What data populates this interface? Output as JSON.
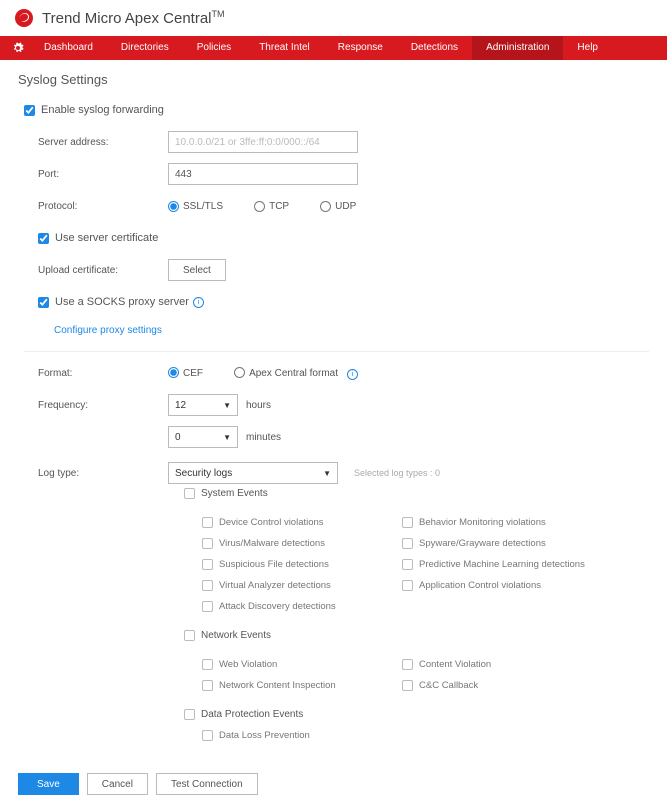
{
  "header": {
    "product": "Trend Micro Apex Central",
    "tm": "TM"
  },
  "nav": {
    "items": [
      "Dashboard",
      "Directories",
      "Policies",
      "Threat Intel",
      "Response",
      "Detections",
      "Administration",
      "Help"
    ],
    "activeIndex": 6
  },
  "page": {
    "title": "Syslog Settings"
  },
  "form": {
    "enable": {
      "label": "Enable syslog forwarding"
    },
    "server": {
      "label": "Server address:",
      "placeholder": "10.0.0.0/21 or 3ffe:ff:0:0/000::/64"
    },
    "port": {
      "label": "Port:",
      "value": "443"
    },
    "protocol": {
      "label": "Protocol:",
      "ssl": "SSL/TLS",
      "tcp": "TCP",
      "udp": "UDP"
    },
    "serverCert": {
      "label": "Use server certificate"
    },
    "upload": {
      "label": "Upload certificate:",
      "button": "Select"
    },
    "socks": {
      "label": "Use a SOCKS proxy server",
      "configure": "Configure proxy settings"
    },
    "format": {
      "label": "Format:",
      "cef": "CEF",
      "apex": "Apex Central format"
    },
    "frequency": {
      "label": "Frequency:",
      "hoursVal": "12",
      "hoursUnit": "hours",
      "minsVal": "0",
      "minsUnit": "minutes"
    },
    "logtype": {
      "label": "Log type:",
      "select": "Security logs",
      "selected": "Selected log types : 0"
    },
    "tree": {
      "systemEvents": "System Events",
      "systemLeft": [
        "Device Control violations",
        "Virus/Malware detections",
        "Suspicious File detections",
        "Virtual Analyzer detections",
        "Attack Discovery detections"
      ],
      "systemRight": [
        "Behavior Monitoring violations",
        "Spyware/Grayware detections",
        "Predictive Machine Learning detections",
        "Application Control violations"
      ],
      "networkEvents": "Network Events",
      "networkLeft": [
        "Web Violation",
        "Network Content Inspection"
      ],
      "networkRight": [
        "Content Violation",
        "C&C Callback"
      ],
      "dataProtection": "Data Protection Events",
      "dataLeft": [
        "Data Loss Prevention"
      ]
    }
  },
  "footer": {
    "save": "Save",
    "cancel": "Cancel",
    "test": "Test Connection"
  }
}
